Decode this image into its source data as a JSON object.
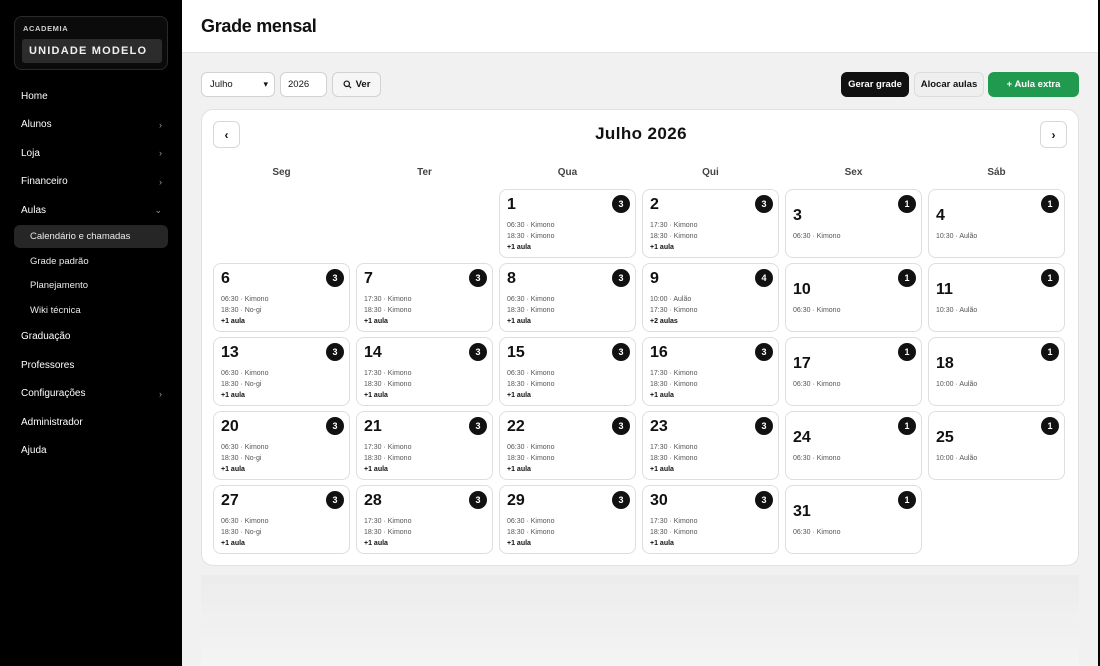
{
  "sidebar": {
    "brand_kicker": "ACADEMIA",
    "brand_name": "UNIDADE MODELO",
    "items": [
      {
        "label": "Home",
        "chevron": ""
      },
      {
        "label": "Alunos",
        "chevron": "›"
      },
      {
        "label": "Loja",
        "chevron": "›"
      },
      {
        "label": "Financeiro",
        "chevron": "›"
      },
      {
        "label": "Aulas",
        "chevron": "⌄"
      }
    ],
    "subitems": [
      {
        "label": "Calendário e chamadas",
        "active": true
      },
      {
        "label": "Grade padrão",
        "active": false
      },
      {
        "label": "Planejamento",
        "active": false
      },
      {
        "label": "Wiki técnica",
        "active": false
      }
    ],
    "items_after": [
      {
        "label": "Graduação",
        "chevron": ""
      },
      {
        "label": "Professores",
        "chevron": ""
      },
      {
        "label": "Configurações",
        "chevron": "›"
      },
      {
        "label": "Administrador",
        "chevron": ""
      },
      {
        "label": "Ajuda",
        "chevron": ""
      }
    ]
  },
  "header": {
    "title": "Grade mensal"
  },
  "toolbar": {
    "month_value": "Julho",
    "year_value": "2026",
    "view_label": "Ver",
    "generate_label": "Gerar grade",
    "allocate_label": "Alocar aulas",
    "extra_label": "+ Aula extra"
  },
  "calendar": {
    "title": "Julho  2026",
    "weekdays": [
      "Seg",
      "Ter",
      "Qua",
      "Qui",
      "Sex",
      "Sáb"
    ],
    "days": [
      {
        "n": "1",
        "col": 2,
        "row": 0,
        "count": "3",
        "lines": [
          "06:30 · Kimono",
          "18:30 · Kimono"
        ],
        "more": "+1 aula"
      },
      {
        "n": "2",
        "col": 3,
        "row": 0,
        "count": "3",
        "lines": [
          "17:30 · Kimono",
          "18:30 · Kimono"
        ],
        "more": "+1 aula"
      },
      {
        "n": "3",
        "col": 4,
        "row": 0,
        "count": "1",
        "lines": [
          "06:30 · Kimono"
        ],
        "more": ""
      },
      {
        "n": "4",
        "col": 5,
        "row": 0,
        "count": "1",
        "lines": [
          "10:30 · Aulão"
        ],
        "more": ""
      },
      {
        "n": "6",
        "col": 0,
        "row": 1,
        "count": "3",
        "lines": [
          "06:30 · Kimono",
          "18:30 · No-gi"
        ],
        "more": "+1 aula"
      },
      {
        "n": "7",
        "col": 1,
        "row": 1,
        "count": "3",
        "lines": [
          "17:30 · Kimono",
          "18:30 · Kimono"
        ],
        "more": "+1 aula"
      },
      {
        "n": "8",
        "col": 2,
        "row": 1,
        "count": "3",
        "lines": [
          "06:30 · Kimono",
          "18:30 · Kimono"
        ],
        "more": "+1 aula"
      },
      {
        "n": "9",
        "col": 3,
        "row": 1,
        "count": "4",
        "lines": [
          "10:00 · Aulão",
          "17:30 · Kimono"
        ],
        "more": "+2 aulas"
      },
      {
        "n": "10",
        "col": 4,
        "row": 1,
        "count": "1",
        "lines": [
          "06:30 · Kimono"
        ],
        "more": ""
      },
      {
        "n": "11",
        "col": 5,
        "row": 1,
        "count": "1",
        "lines": [
          "10:30 · Aulão"
        ],
        "more": ""
      },
      {
        "n": "13",
        "col": 0,
        "row": 2,
        "count": "3",
        "lines": [
          "06:30 · Kimono",
          "18:30 · No-gi"
        ],
        "more": "+1 aula"
      },
      {
        "n": "14",
        "col": 1,
        "row": 2,
        "count": "3",
        "lines": [
          "17:30 · Kimono",
          "18:30 · Kimono"
        ],
        "more": "+1 aula"
      },
      {
        "n": "15",
        "col": 2,
        "row": 2,
        "count": "3",
        "lines": [
          "06:30 · Kimono",
          "18:30 · Kimono"
        ],
        "more": "+1 aula"
      },
      {
        "n": "16",
        "col": 3,
        "row": 2,
        "count": "3",
        "lines": [
          "17:30 · Kimono",
          "18:30 · Kimono"
        ],
        "more": "+1 aula"
      },
      {
        "n": "17",
        "col": 4,
        "row": 2,
        "count": "1",
        "lines": [
          "06:30 · Kimono"
        ],
        "more": ""
      },
      {
        "n": "18",
        "col": 5,
        "row": 2,
        "count": "1",
        "lines": [
          "10:00 · Aulão"
        ],
        "more": ""
      },
      {
        "n": "20",
        "col": 0,
        "row": 3,
        "count": "3",
        "lines": [
          "06:30 · Kimono",
          "18:30 · No-gi"
        ],
        "more": "+1 aula"
      },
      {
        "n": "21",
        "col": 1,
        "row": 3,
        "count": "3",
        "lines": [
          "17:30 · Kimono",
          "18:30 · Kimono"
        ],
        "more": "+1 aula"
      },
      {
        "n": "22",
        "col": 2,
        "row": 3,
        "count": "3",
        "lines": [
          "06:30 · Kimono",
          "18:30 · Kimono"
        ],
        "more": "+1 aula"
      },
      {
        "n": "23",
        "col": 3,
        "row": 3,
        "count": "3",
        "lines": [
          "17:30 · Kimono",
          "18:30 · Kimono"
        ],
        "more": "+1 aula"
      },
      {
        "n": "24",
        "col": 4,
        "row": 3,
        "count": "1",
        "lines": [
          "06:30 · Kimono"
        ],
        "more": ""
      },
      {
        "n": "25",
        "col": 5,
        "row": 3,
        "count": "1",
        "lines": [
          "10:00 · Aulão"
        ],
        "more": ""
      },
      {
        "n": "27",
        "col": 0,
        "row": 4,
        "count": "3",
        "lines": [
          "06:30 · Kimono",
          "18:30 · No-gi"
        ],
        "more": "+1 aula"
      },
      {
        "n": "28",
        "col": 1,
        "row": 4,
        "count": "3",
        "lines": [
          "17:30 · Kimono",
          "18:30 · Kimono"
        ],
        "more": "+1 aula"
      },
      {
        "n": "29",
        "col": 2,
        "row": 4,
        "count": "3",
        "lines": [
          "06:30 · Kimono",
          "18:30 · Kimono"
        ],
        "more": "+1 aula"
      },
      {
        "n": "30",
        "col": 3,
        "row": 4,
        "count": "3",
        "lines": [
          "17:30 · Kimono",
          "18:30 · Kimono"
        ],
        "more": "+1 aula"
      },
      {
        "n": "31",
        "col": 4,
        "row": 4,
        "count": "1",
        "lines": [
          "06:30 · Kimono"
        ],
        "more": ""
      }
    ]
  },
  "colors": {
    "accent_green": "#1f9a4f",
    "dark": "#111111",
    "sidebar_bg": "#000000"
  }
}
